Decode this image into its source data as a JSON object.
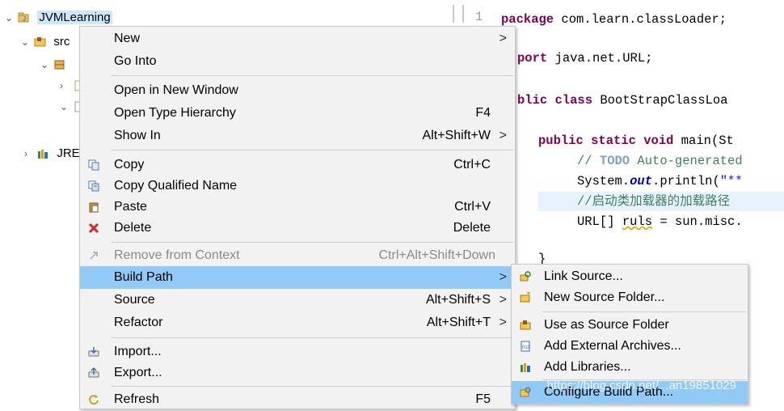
{
  "tree": {
    "project": "JVMLearning",
    "src": "src",
    "jre": "JRE"
  },
  "editor": {
    "line_number": "1",
    "lines": [
      {
        "kw": "package",
        "rest": " com.learn.classLoader;"
      },
      {
        "kw": "port",
        "rest": " java.net.URL;"
      },
      {
        "kw": "blic class",
        "rest": " BootStrapClassLoa"
      },
      {
        "kw": "public static void",
        "rest": " main(St"
      },
      {
        "comment": "// ",
        "todo": "TODO",
        "rest": " Auto-generated"
      },
      {
        "pre": "System.",
        "field": "out",
        "mid": ".println(",
        "str": "\"**"
      },
      {
        "comment": "//启动类加载器的加载路径"
      },
      {
        "pre": "URL[] ",
        "var": "ruls",
        "rest": " = sun.misc."
      },
      {
        "brace": "}"
      }
    ]
  },
  "context_menu": {
    "items": [
      {
        "label": "New",
        "accel": "",
        "submenu": true
      },
      {
        "label": "Go Into",
        "accel": ""
      },
      {
        "label": "Open in New Window",
        "accel": ""
      },
      {
        "label": "Open Type Hierarchy",
        "accel": "F4"
      },
      {
        "label": "Show In",
        "accel": "Alt+Shift+W",
        "submenu": true
      },
      {
        "label": "Copy",
        "accel": "Ctrl+C",
        "icon": "copy-icon"
      },
      {
        "label": "Copy Qualified Name",
        "accel": "",
        "icon": "copy-qualified-icon"
      },
      {
        "label": "Paste",
        "accel": "Ctrl+V",
        "icon": "paste-icon"
      },
      {
        "label": "Delete",
        "accel": "Delete",
        "icon": "delete-icon"
      },
      {
        "label": "Remove from Context",
        "accel": "Ctrl+Alt+Shift+Down",
        "icon": "remove-context-icon",
        "disabled": true
      },
      {
        "label": "Build Path",
        "accel": "",
        "submenu": true,
        "selected": true
      },
      {
        "label": "Source",
        "accel": "Alt+Shift+S",
        "submenu": true
      },
      {
        "label": "Refactor",
        "accel": "Alt+Shift+T",
        "submenu": true
      },
      {
        "label": "Import...",
        "accel": "",
        "icon": "import-icon"
      },
      {
        "label": "Export...",
        "accel": "",
        "icon": "export-icon"
      },
      {
        "label": "Refresh",
        "accel": "F5",
        "icon": "refresh-icon"
      }
    ],
    "submenu_arrow": ">"
  },
  "build_path_menu": {
    "items": [
      {
        "label": "Link Source...",
        "icon": "link-source-icon"
      },
      {
        "label": "New Source Folder...",
        "icon": "new-source-folder-icon"
      },
      {
        "label": "Use as Source Folder",
        "icon": "use-source-folder-icon"
      },
      {
        "label": "Add External Archives...",
        "icon": "external-archive-icon"
      },
      {
        "label": "Add Libraries...",
        "icon": "libraries-icon"
      },
      {
        "label": "Configure Build Path...",
        "icon": "configure-build-path-icon",
        "selected": true
      }
    ],
    "watermark": "https://blog.csdn.net/...an19851029"
  },
  "colors": {
    "menu_bg": "#f2f2f2",
    "selected": "#91c9f7",
    "keyword": "#7f0055",
    "comment": "#3f7f5f",
    "string": "#2a00ff"
  }
}
